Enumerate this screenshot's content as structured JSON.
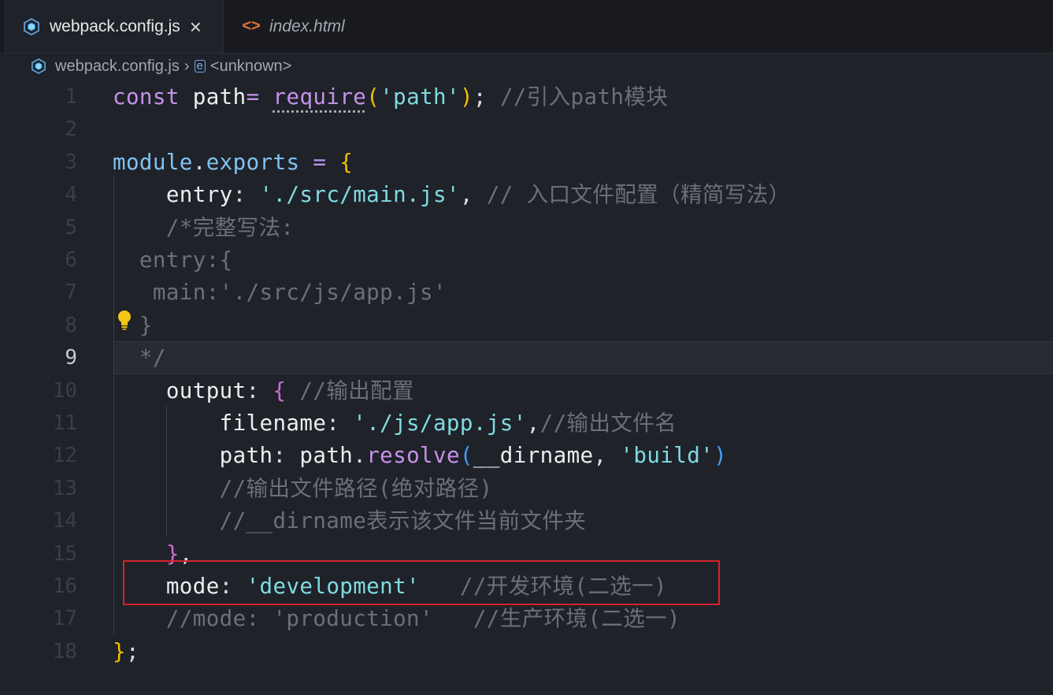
{
  "tabs": [
    {
      "label": "webpack.config.js",
      "active": true,
      "icon": "webpack-icon"
    },
    {
      "label": "index.html",
      "active": false,
      "icon": "html-code-icon"
    }
  ],
  "breadcrumb": {
    "file": "webpack.config.js",
    "symbol": "<unknown>"
  },
  "editor": {
    "active_line": 9,
    "line_numbers": [
      "1",
      "2",
      "3",
      "4",
      "5",
      "6",
      "7",
      "8",
      "9",
      "10",
      "11",
      "12",
      "13",
      "14",
      "15",
      "16",
      "17",
      "18"
    ],
    "lines": [
      [
        {
          "t": "const",
          "c": "kw"
        },
        {
          "t": " path",
          "c": "prop"
        },
        {
          "t": "=",
          "c": "kw"
        },
        {
          "t": " ",
          "c": "pun"
        },
        {
          "t": "require",
          "c": "fn",
          "squiggle": true
        },
        {
          "t": "(",
          "c": "br1"
        },
        {
          "t": "'path'",
          "c": "str"
        },
        {
          "t": ")",
          "c": "br1"
        },
        {
          "t": "; ",
          "c": "pun"
        },
        {
          "t": "//引入path模块",
          "c": "cm"
        }
      ],
      [],
      [
        {
          "t": "module",
          "c": "var"
        },
        {
          "t": ".",
          "c": "pun"
        },
        {
          "t": "exports",
          "c": "var"
        },
        {
          "t": " = ",
          "c": "kw"
        },
        {
          "t": "{",
          "c": "br1"
        }
      ],
      [
        {
          "t": "    entry",
          "c": "prop"
        },
        {
          "t": ": ",
          "c": "pun"
        },
        {
          "t": "'./src/main.js'",
          "c": "str"
        },
        {
          "t": ", ",
          "c": "pun"
        },
        {
          "t": "// 入口文件配置（精简写法）",
          "c": "cm"
        }
      ],
      [
        {
          "t": "    /*完整写法:",
          "c": "cm"
        }
      ],
      [
        {
          "t": "  entry:{",
          "c": "cm"
        }
      ],
      [
        {
          "t": "   main:'./src/js/app.js'",
          "c": "cm"
        }
      ],
      [
        {
          "t": "  }",
          "c": "cm"
        }
      ],
      [
        {
          "t": "  */",
          "c": "cm"
        }
      ],
      [
        {
          "t": "    output",
          "c": "prop"
        },
        {
          "t": ": ",
          "c": "pun"
        },
        {
          "t": "{",
          "c": "br2"
        },
        {
          "t": " //输出配置",
          "c": "cm"
        }
      ],
      [
        {
          "t": "        filename",
          "c": "prop"
        },
        {
          "t": ": ",
          "c": "pun"
        },
        {
          "t": "'./js/app.js'",
          "c": "str"
        },
        {
          "t": ",",
          "c": "pun"
        },
        {
          "t": "//输出文件名",
          "c": "cm"
        }
      ],
      [
        {
          "t": "        path",
          "c": "prop"
        },
        {
          "t": ": ",
          "c": "pun"
        },
        {
          "t": "path",
          "c": "prop"
        },
        {
          "t": ".",
          "c": "pun"
        },
        {
          "t": "resolve",
          "c": "fn"
        },
        {
          "t": "(",
          "c": "br3"
        },
        {
          "t": "__dirname",
          "c": "prop"
        },
        {
          "t": ", ",
          "c": "pun"
        },
        {
          "t": "'build'",
          "c": "str"
        },
        {
          "t": ")",
          "c": "br3"
        }
      ],
      [
        {
          "t": "        //输出文件路径(绝对路径)",
          "c": "cm"
        }
      ],
      [
        {
          "t": "        //__dirname表示该文件当前文件夹",
          "c": "cm"
        }
      ],
      [
        {
          "t": "    ",
          "c": "pun"
        },
        {
          "t": "}",
          "c": "br2"
        },
        {
          "t": ",",
          "c": "pun"
        }
      ],
      [
        {
          "t": "    mode",
          "c": "prop"
        },
        {
          "t": ": ",
          "c": "pun"
        },
        {
          "t": "'development'",
          "c": "str"
        },
        {
          "t": "   //开发环境(二选一)",
          "c": "cm"
        }
      ],
      [
        {
          "t": "    //mode: 'production'   //生产环境(二选一)",
          "c": "cm"
        }
      ],
      [
        {
          "t": "}",
          "c": "br1"
        },
        {
          "t": ";",
          "c": "pun"
        }
      ]
    ]
  },
  "colors": {
    "highlight_box": "#d5232c",
    "background": "#1f2229",
    "lightbulb": "#f5c518"
  }
}
